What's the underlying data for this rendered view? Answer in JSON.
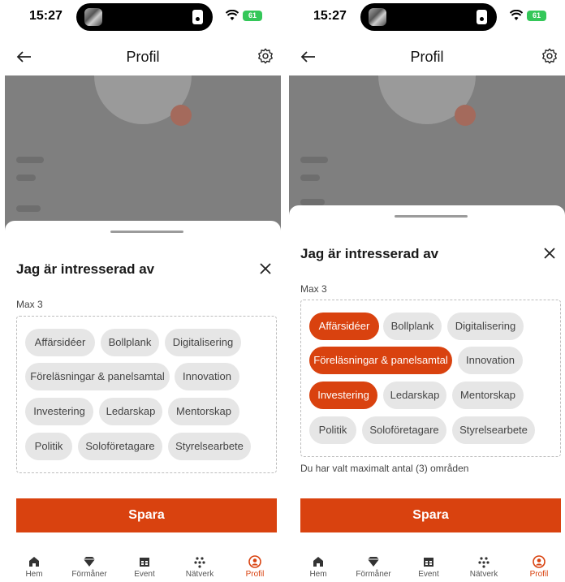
{
  "status": {
    "time": "15:27",
    "battery": "61"
  },
  "header": {
    "title": "Profil"
  },
  "sheet": {
    "title": "Jag är intresserad av",
    "max_label": "Max 3",
    "save_label": "Spara",
    "limit_note": "Du har valt maximalt antal (3) områden"
  },
  "interests": [
    {
      "label": "Affärsidéer",
      "selected_right": true
    },
    {
      "label": "Bollplank",
      "selected_right": false
    },
    {
      "label": "Digitalisering",
      "selected_right": false
    },
    {
      "label": "Föreläsningar & panelsamtal",
      "selected_right": true
    },
    {
      "label": "Innovation",
      "selected_right": false
    },
    {
      "label": "Investering",
      "selected_right": true
    },
    {
      "label": "Ledarskap",
      "selected_right": false
    },
    {
      "label": "Mentorskap",
      "selected_right": false
    },
    {
      "label": "Politik",
      "selected_right": false
    },
    {
      "label": "Soloföretagare",
      "selected_right": false
    },
    {
      "label": "Styrelsearbete",
      "selected_right": false
    }
  ],
  "tabs": [
    {
      "label": "Hem",
      "icon": "home-icon",
      "active": false
    },
    {
      "label": "Förmåner",
      "icon": "diamond-icon",
      "active": false
    },
    {
      "label": "Event",
      "icon": "calendar-icon",
      "active": false
    },
    {
      "label": "Nätverk",
      "icon": "network-icon",
      "active": false
    },
    {
      "label": "Profil",
      "icon": "profile-icon",
      "active": true
    }
  ],
  "colors": {
    "accent": "#d9420f",
    "chip": "#e6e6e6",
    "backdrop": "#7f7f7f"
  }
}
